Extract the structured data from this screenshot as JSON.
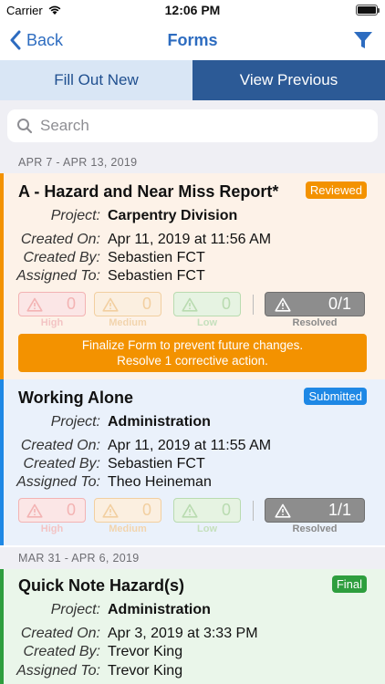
{
  "status_bar": {
    "carrier": "Carrier",
    "time": "12:06 PM"
  },
  "nav": {
    "back_label": "Back",
    "title": "Forms"
  },
  "tabs": [
    {
      "label": "Fill Out New"
    },
    {
      "label": "View Previous"
    }
  ],
  "search": {
    "placeholder": "Search"
  },
  "sections": [
    {
      "header": "APR 7 - APR 13, 2019",
      "forms": [
        {
          "title": "A - Hazard and Near Miss Report*",
          "status": "Reviewed",
          "status_color": "#f39200",
          "rows": [
            {
              "label": "Project:",
              "value": "Carpentry Division"
            },
            {
              "label": "Created On:",
              "value": "Apr 11, 2019 at 11:56 AM"
            },
            {
              "label": "Created By:",
              "value": "Sebastien FCT"
            },
            {
              "label": "Assigned To:",
              "value": "Sebastien FCT"
            }
          ],
          "stats": [
            {
              "label": "High",
              "value": "0"
            },
            {
              "label": "Medium",
              "value": "0"
            },
            {
              "label": "Low",
              "value": "0"
            },
            {
              "label": "Resolved",
              "value": "0/1"
            }
          ],
          "notice": {
            "line1": "Finalize Form to prevent future changes.",
            "line2": "Resolve 1 corrective action."
          }
        },
        {
          "title": "Working Alone",
          "status": "Submitted",
          "status_color": "#1e88e5",
          "rows": [
            {
              "label": "Project:",
              "value": "Administration"
            },
            {
              "label": "Created On:",
              "value": "Apr 11, 2019 at 11:55 AM"
            },
            {
              "label": "Created By:",
              "value": "Sebastien FCT"
            },
            {
              "label": "Assigned To:",
              "value": "Theo Heineman"
            }
          ],
          "stats": [
            {
              "label": "High",
              "value": "0"
            },
            {
              "label": "Medium",
              "value": "0"
            },
            {
              "label": "Low",
              "value": "0"
            },
            {
              "label": "Resolved",
              "value": "1/1"
            }
          ]
        }
      ]
    },
    {
      "header": "MAR 31 - APR 6, 2019",
      "forms": [
        {
          "title": "Quick Note Hazard(s)",
          "status": "Final",
          "status_color": "#2e9e3e",
          "rows": [
            {
              "label": "Project:",
              "value": "Administration"
            },
            {
              "label": "Created On:",
              "value": "Apr 3, 2019 at 3:33 PM"
            },
            {
              "label": "Created By:",
              "value": "Trevor King"
            },
            {
              "label": "Assigned To:",
              "value": "Trevor King"
            }
          ]
        }
      ]
    }
  ],
  "colors": {
    "accent_blue": "#2d6cc0",
    "reviewed_bg": "#fdf2e8",
    "submitted_bg": "#eaf1fb",
    "final_bg": "#eaf6ea"
  }
}
